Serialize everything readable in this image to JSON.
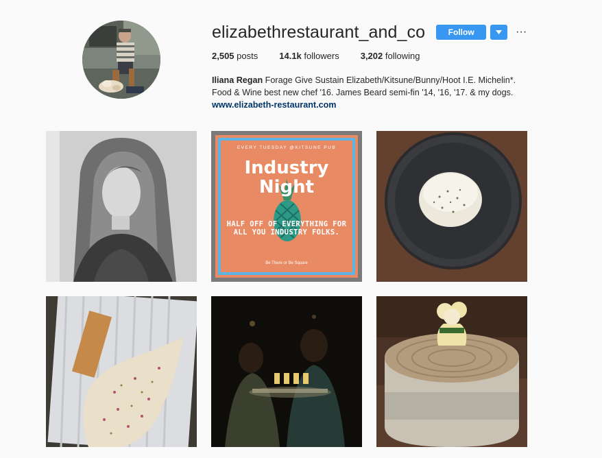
{
  "profile": {
    "username": "elizabethrestaurant_and_co",
    "follow_label": "Follow",
    "dropdown_icon": "chevron-down-icon",
    "more_label": "···",
    "stats": {
      "posts_count": "2,505",
      "posts_label": "posts",
      "followers_count": "14.1k",
      "followers_label": "followers",
      "following_count": "3,202",
      "following_label": "following"
    },
    "bio": {
      "name": "Iliana Regan",
      "text": " Forage Give Sustain Elizabeth/Kitsune/Bunny/Hoot I.E. Michelin*. Food & Wine best new chef '16. James Beard semi-fin '14, '16, '17. & my dogs.",
      "link": "www.elizabeth-restaurant.com"
    }
  },
  "posts": {
    "industry_poster": {
      "top_line": "EVERY TUESDAY @KITSUNE PUB",
      "title_line1": "Industry",
      "title_line2": "Night",
      "subtitle": "HALF OFF OF EVERYTHING FOR ALL YOU INDUSTRY FOLKS.",
      "footer": "Be There or Be Square"
    }
  },
  "colors": {
    "accent": "#3897f0",
    "link": "#003569",
    "poster_bg": "#e88a63",
    "poster_border": "#5cb3e4"
  }
}
